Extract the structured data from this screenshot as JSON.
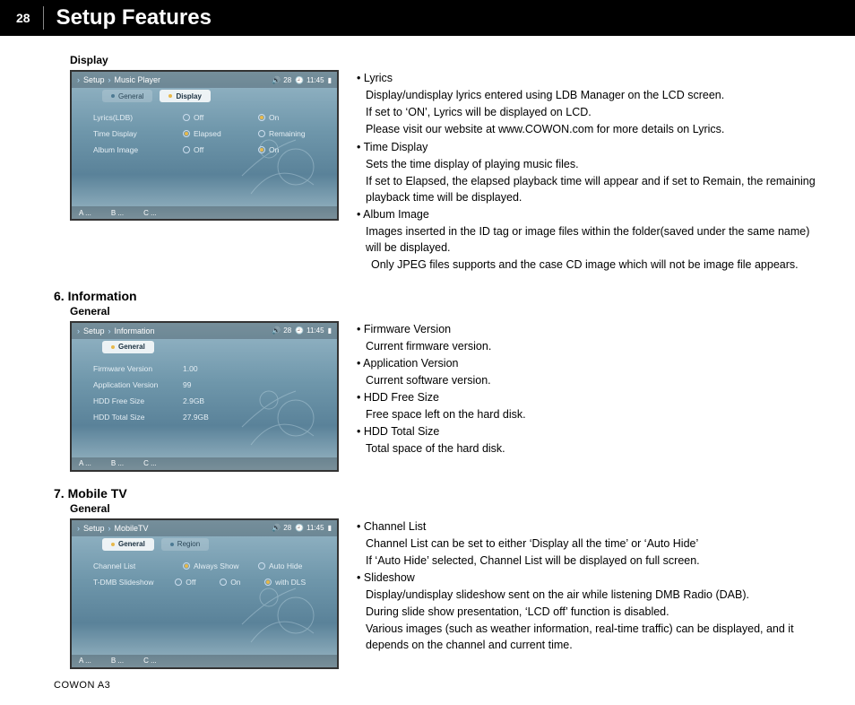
{
  "page_number": "28",
  "page_title": "Setup Features",
  "footer_model": "COWON A3",
  "status": {
    "battery": "28",
    "clock": "11:45"
  },
  "display": {
    "subheading": "Display",
    "breadcrumb": {
      "a": "Setup",
      "b": "Music Player"
    },
    "tabs": {
      "t1": "General",
      "t2": "Display"
    },
    "rows": {
      "r1": {
        "label": "Lyrics(LDB)",
        "o1": "Off",
        "o2": "On"
      },
      "r2": {
        "label": "Time Display",
        "o1": "Elapsed",
        "o2": "Remaining"
      },
      "r3": {
        "label": "Album Image",
        "o1": "Off",
        "o2": "On"
      }
    },
    "text": {
      "lyrics_h": "Lyrics",
      "lyrics_1": "Display/undisplay lyrics entered using LDB Manager on the LCD screen.",
      "lyrics_2": "If set to ‘ON’, Lyrics will be displayed on LCD.",
      "lyrics_3": "Please visit our website at www.COWON.com for more details on Lyrics.",
      "time_h": "Time Display",
      "time_1": "Sets the time display of playing music files.",
      "time_2": "If set to Elapsed, the elapsed playback time will appear and if set to Remain, the remaining playback time will be displayed.",
      "album_h": "Album Image",
      "album_1": "Images inserted in the ID tag or image files within the folder(saved under the same name) will be displayed.",
      "album_2": "Only JPEG files supports and the case CD image which will not be image file appears."
    }
  },
  "information": {
    "heading": "6. Information",
    "subheading": "General",
    "breadcrumb": {
      "a": "Setup",
      "b": "Information"
    },
    "tab": "General",
    "rows": {
      "r1": {
        "label": "Firmware Version",
        "val": "1.00"
      },
      "r2": {
        "label": "Application Version",
        "val": "99"
      },
      "r3": {
        "label": "HDD Free Size",
        "val": "2.9GB"
      },
      "r4": {
        "label": "HDD Total Size",
        "val": "27.9GB"
      }
    },
    "text": {
      "fw_h": "Firmware Version",
      "fw_1": "Current firmware version.",
      "app_h": "Application Version",
      "app_1": "Current software version.",
      "free_h": "HDD Free Size",
      "free_1": "Free space left on the hard disk.",
      "tot_h": "HDD Total Size",
      "tot_1": "Total space of the hard disk."
    }
  },
  "mobiletv": {
    "heading": "7. Mobile TV",
    "subheading": "General",
    "breadcrumb": {
      "a": "Setup",
      "b": "MobileTV"
    },
    "tabs": {
      "t1": "General",
      "t2": "Region"
    },
    "rows": {
      "r1": {
        "label": "Channel List",
        "o1": "Always Show",
        "o2": "Auto Hide"
      },
      "r2": {
        "label": "T-DMB Slideshow",
        "o1": "Off",
        "o2": "On",
        "o3": "with DLS"
      }
    },
    "text": {
      "ch_h": "Channel List",
      "ch_1": "Channel List can be set to either ‘Display all the time’ or ‘Auto Hide’",
      "ch_2": "If ‘Auto Hide’ selected, Channel List will be displayed on full screen.",
      "ss_h": "Slideshow",
      "ss_1": "Display/undisplay slideshow sent on the air while listening DMB Radio (DAB).",
      "ss_2": "During slide show presentation, ‘LCD off’ function is disabled.",
      "ss_3": "Various images (such as weather information, real-time traffic) can be displayed, and it depends on the channel and current time."
    }
  },
  "softkeys": {
    "a": "A",
    "b": "B",
    "c": "C",
    "dots": "..."
  }
}
